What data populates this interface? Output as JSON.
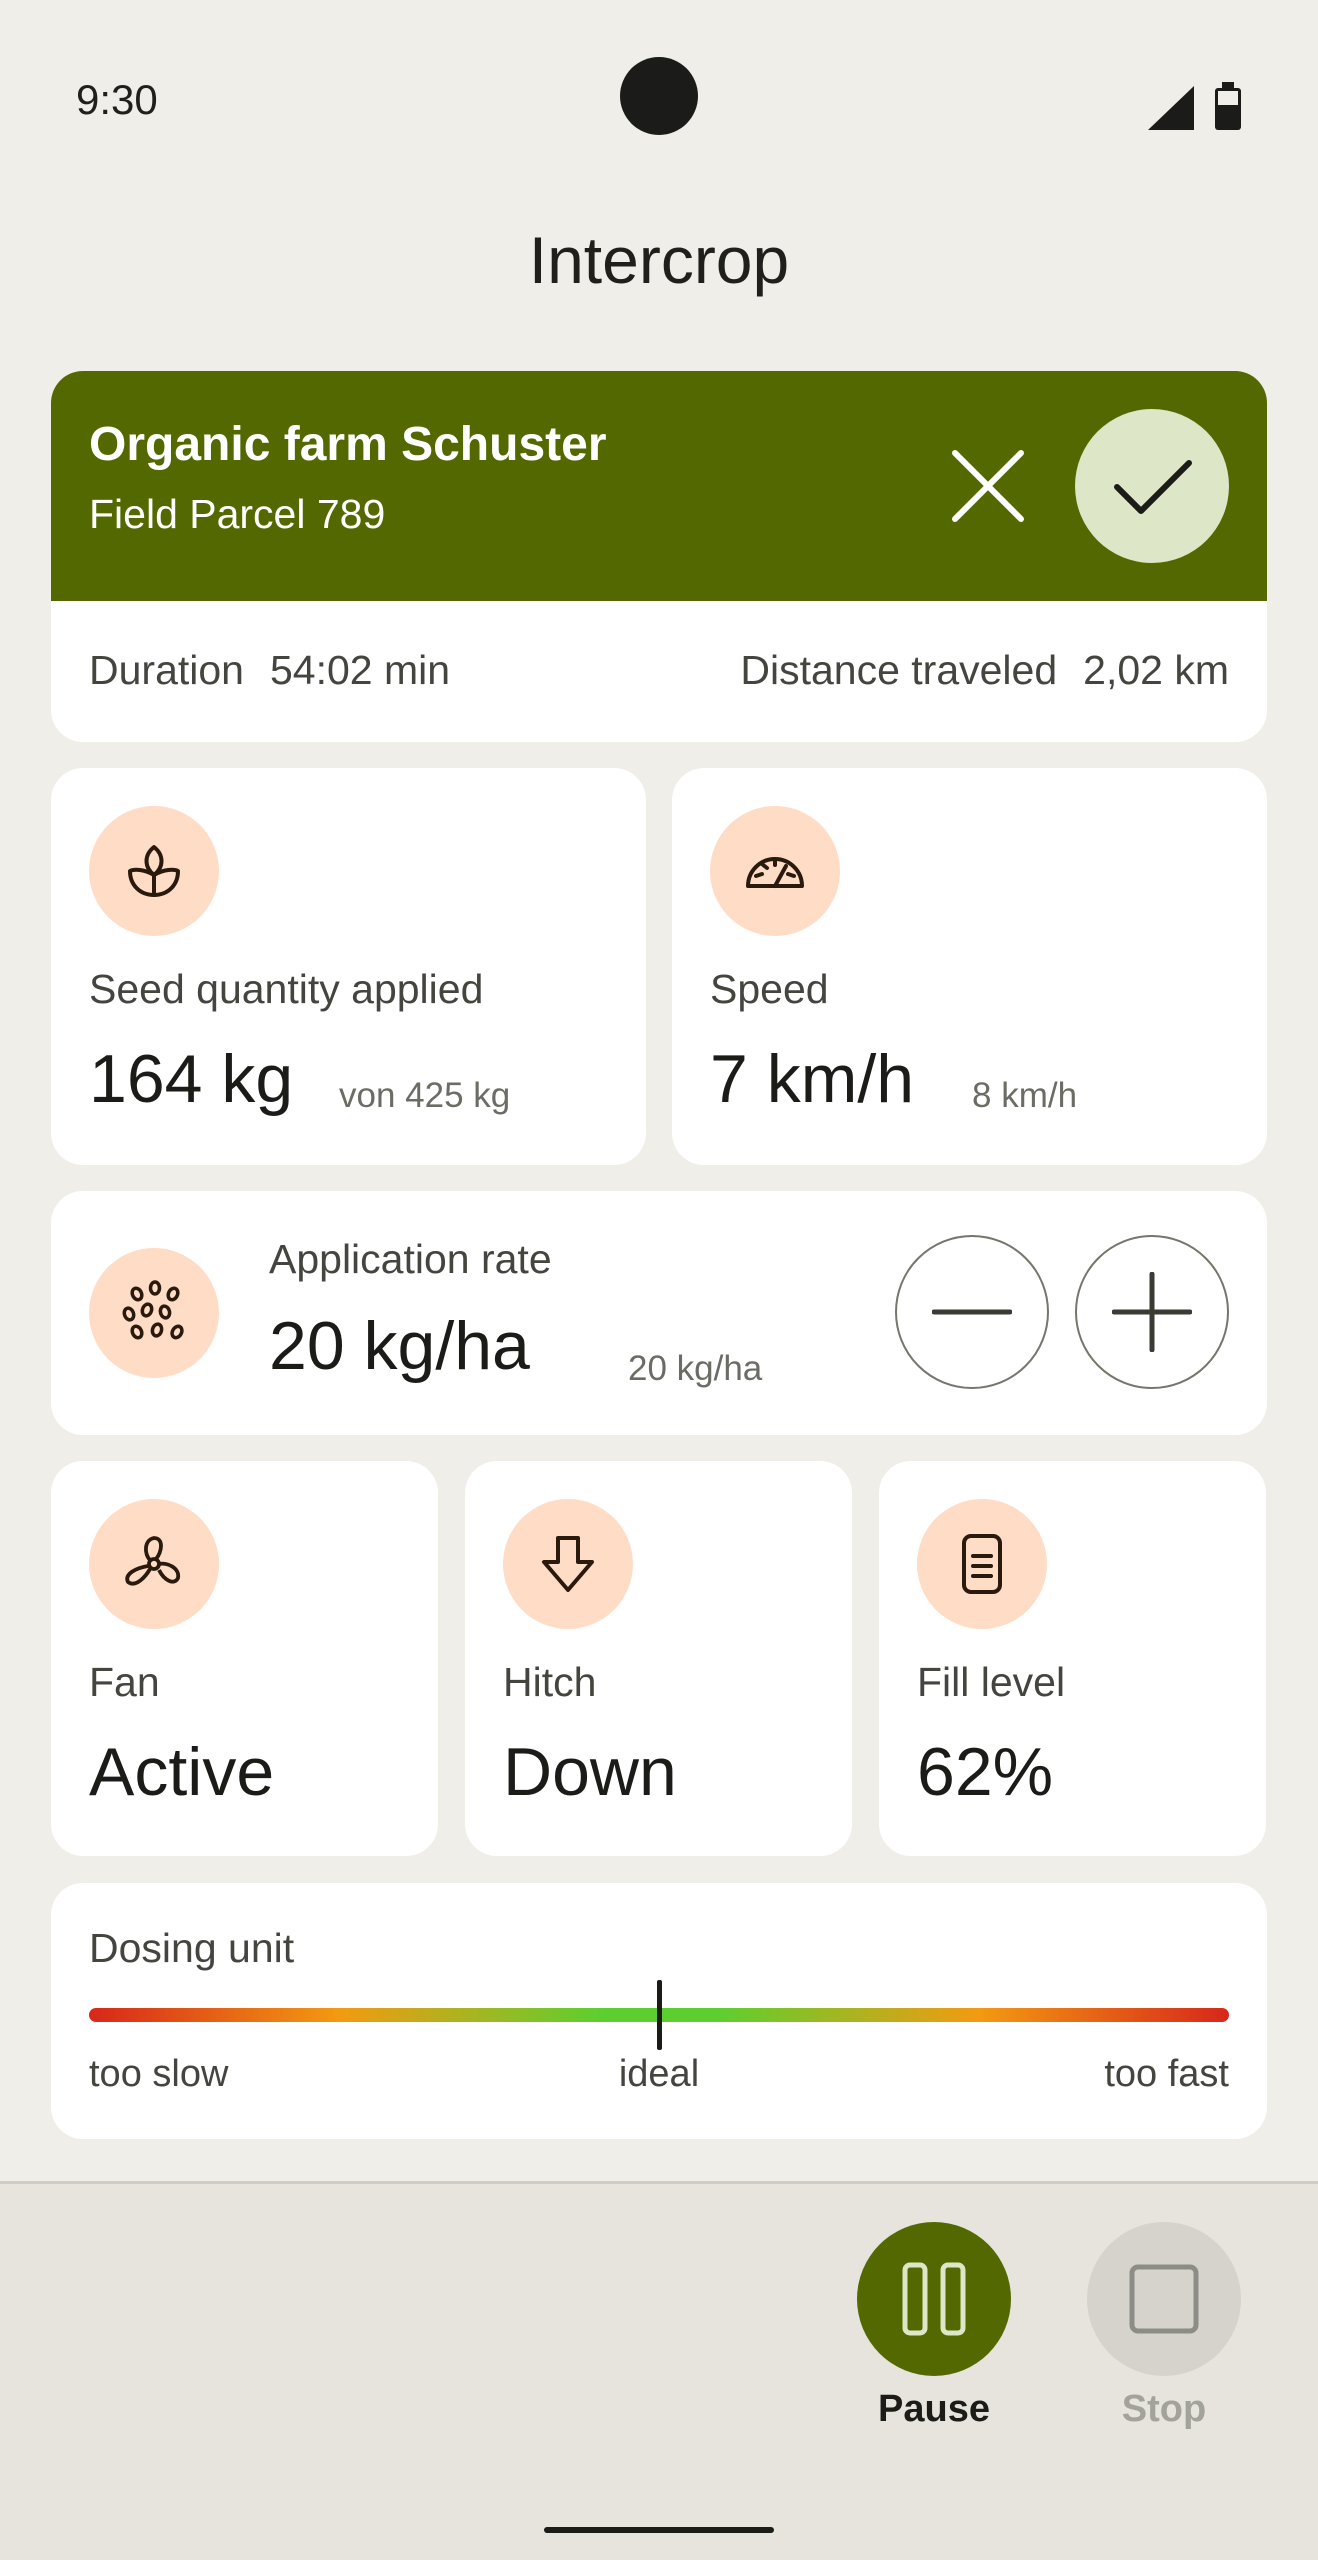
{
  "status_bar": {
    "time": "9:30"
  },
  "page": {
    "title": "Intercrop"
  },
  "session": {
    "farm_name": "Organic farm Schuster",
    "field_name": "Field Parcel 789",
    "duration_label": "Duration",
    "duration_value": "54:02 min",
    "distance_label": "Distance traveled",
    "distance_value": "2,02 km"
  },
  "seed": {
    "label": "Seed quantity applied",
    "value": "164 kg",
    "sub": "von 425 kg",
    "icon": "sprout-icon"
  },
  "speed": {
    "label": "Speed",
    "value": "7 km/h",
    "sub": "8 km/h",
    "icon": "speedometer-icon"
  },
  "rate": {
    "label": "Application rate",
    "value": "20 kg/ha",
    "sub": "20 kg/ha",
    "icon": "seeds-icon"
  },
  "fan": {
    "label": "Fan",
    "value": "Active",
    "icon": "fan-icon"
  },
  "hitch": {
    "label": "Hitch",
    "value": "Down",
    "icon": "arrow-down-icon"
  },
  "fill": {
    "label": "Fill level",
    "value": "62%",
    "icon": "document-icon"
  },
  "dosing": {
    "label": "Dosing unit",
    "slow": "too slow",
    "ideal": "ideal",
    "fast": "too fast",
    "position": 0.5
  },
  "actions": {
    "pause": "Pause",
    "stop": "Stop"
  },
  "colors": {
    "primary": "#536900",
    "icon_bg": "#ffdcc5",
    "confirm_bg": "#dde7c7",
    "background": "#f0eee9"
  }
}
